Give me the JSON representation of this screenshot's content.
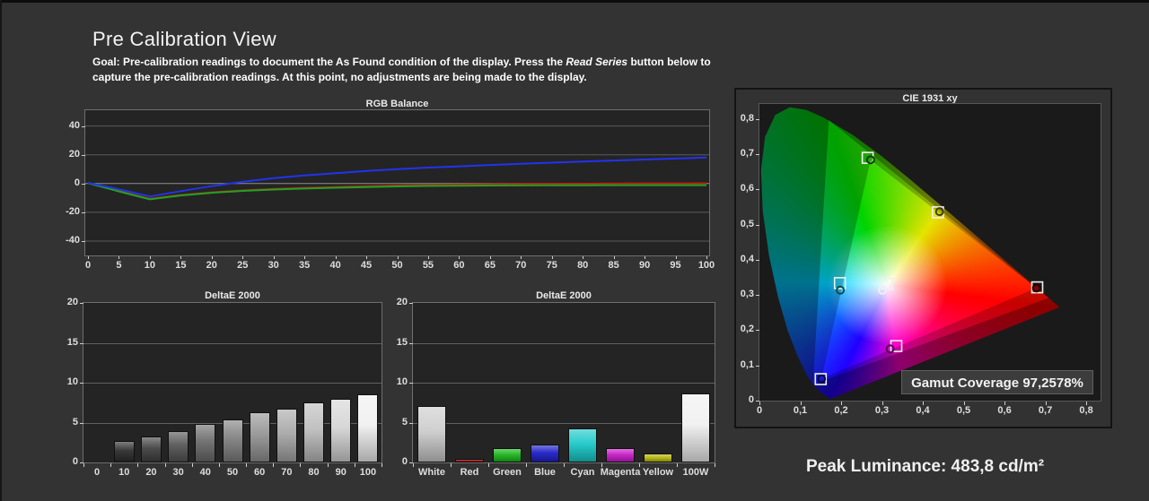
{
  "header": {
    "title": "Pre Calibration View",
    "goal": {
      "line1_pre": "Goal: Pre-calibration readings to document the As Found condition of the display. Press the ",
      "line1_italic": "Read Series",
      "line1_post": " button below to",
      "line2": "capture the pre-calibration readings. At this point, no adjustments are being made to the display."
    }
  },
  "footer": {
    "peak_luminance": "Peak Luminance: 483,8 cd/m²"
  },
  "colors": {
    "page_bg": "#333333",
    "plot_bg": "#242424",
    "grid": "#5a5a5a",
    "zero_line": "#8f8f8f",
    "axis_text": "#dedede",
    "red_line": "#bb2211",
    "green_line": "#22a022",
    "blue_line": "#2233ee"
  },
  "chart_data": [
    {
      "id": "rgb_balance",
      "type": "line",
      "title": "RGB Balance",
      "xlim": [
        0,
        100
      ],
      "ylim": [
        -50,
        51
      ],
      "xticks": [
        0,
        5,
        10,
        15,
        20,
        25,
        30,
        35,
        40,
        45,
        50,
        55,
        60,
        65,
        70,
        75,
        80,
        85,
        90,
        95,
        100
      ],
      "yticks": [
        40,
        20,
        0,
        -20,
        -40
      ],
      "x": [
        0,
        5,
        10,
        15,
        20,
        25,
        30,
        35,
        40,
        45,
        50,
        55,
        60,
        65,
        70,
        75,
        80,
        85,
        90,
        95,
        100
      ],
      "series": [
        {
          "name": "red",
          "color": "#bb2211",
          "values": [
            0.4,
            -5.2,
            -10.6,
            -8,
            -6.1,
            -4.8,
            -3.8,
            -3,
            -2.4,
            -1.9,
            -1.4,
            -1,
            -0.7,
            -0.5,
            -0.3,
            -0.2,
            -0.1,
            0,
            0.1,
            0.1,
            0.2
          ]
        },
        {
          "name": "green",
          "color": "#22a022",
          "values": [
            0.3,
            -5.5,
            -11,
            -8.3,
            -6.4,
            -5.1,
            -4.2,
            -3.5,
            -2.9,
            -2.4,
            -2,
            -1.7,
            -1.5,
            -1.4,
            -1.3,
            -1.2,
            -1.2,
            -1.1,
            -1.1,
            -1.1,
            -1.1
          ]
        },
        {
          "name": "blue",
          "color": "#2233ee",
          "values": [
            0.5,
            -4,
            -9,
            -5.3,
            -1.8,
            1.2,
            3.8,
            5.6,
            7.2,
            8.7,
            10,
            11.1,
            12,
            12.9,
            13.7,
            14.5,
            15.3,
            16,
            16.7,
            17.4,
            18.1
          ]
        }
      ],
      "grid": true,
      "legend": "none"
    },
    {
      "id": "deltae_grayscale",
      "type": "bar",
      "title": "DeltaE 2000",
      "categories": [
        "0",
        "10",
        "20",
        "30",
        "40",
        "50",
        "60",
        "70",
        "80",
        "90",
        "100"
      ],
      "values": [
        0,
        2.7,
        3.3,
        3.9,
        4.8,
        5.4,
        6.3,
        6.8,
        7.5,
        8.0,
        8.6
      ],
      "colors": [
        "#222222",
        "#2e2e2e",
        "#424242",
        "#565656",
        "#6c6c6c",
        "#808080",
        "#949494",
        "#a8a8a8",
        "#bdbdbd",
        "#d5d5d5",
        "#f0f0f0"
      ],
      "ylim": [
        0,
        20
      ],
      "yticks": [
        0,
        5,
        10,
        15,
        20
      ],
      "grid": true,
      "legend": "none"
    },
    {
      "id": "deltae_colors",
      "type": "bar",
      "title": "DeltaE 2000",
      "categories": [
        "White",
        "Red",
        "Green",
        "Blue",
        "Cyan",
        "Magenta",
        "Yellow",
        "100W"
      ],
      "values": [
        7.1,
        0.5,
        1.8,
        2.3,
        4.3,
        1.8,
        1.1,
        8.7
      ],
      "colors": [
        "#cccccc",
        "#a01010",
        "#1cb51c",
        "#2020c8",
        "#1cc8c8",
        "#c81cc8",
        "#b8b810",
        "#f0f0f0"
      ],
      "ylim": [
        0,
        20
      ],
      "yticks": [
        0,
        5,
        10,
        15,
        20
      ],
      "grid": true,
      "legend": "none"
    },
    {
      "id": "cie1931",
      "type": "scatter",
      "title": "CIE 1931 xy",
      "xlim": [
        0,
        0.835
      ],
      "ylim": [
        0,
        0.843
      ],
      "ticks": [
        0,
        0.1,
        0.2,
        0.3,
        0.4,
        0.5,
        0.6,
        0.7,
        0.8
      ],
      "xtick_labels": [
        "0",
        "0,1",
        "0,2",
        "0,3",
        "0,4",
        "0,5",
        "0,6",
        "0,7",
        "0,8"
      ],
      "ytick_labels": [
        "0",
        "0,1",
        "0,2",
        "0,3",
        "0,4",
        "0,5",
        "0,6",
        "0,7",
        "0,8"
      ],
      "coverage_label": "Gamut Coverage 97,2578%",
      "reference_triangle": [
        [
          0.708,
          0.292
        ],
        [
          0.17,
          0.797
        ],
        [
          0.131,
          0.046
        ]
      ],
      "display_triangle": [
        [
          0.678,
          0.32
        ],
        [
          0.272,
          0.684
        ],
        [
          0.152,
          0.062
        ]
      ],
      "points": [
        {
          "name": "white",
          "target": [
            0.313,
            0.332
          ],
          "measured": [
            0.301,
            0.314
          ],
          "measured_stroke": "#f0f0f0"
        },
        {
          "name": "red",
          "target": [
            0.68,
            0.322
          ],
          "measured": [
            0.678,
            0.32
          ],
          "measured_stroke": "#1a0000",
          "measured_fill": "#7a0000"
        },
        {
          "name": "green",
          "target": [
            0.265,
            0.69
          ],
          "measured": [
            0.272,
            0.684
          ],
          "measured_stroke": "#0b3d0b"
        },
        {
          "name": "blue",
          "target": [
            0.15,
            0.061
          ],
          "measured": [
            0.152,
            0.062
          ],
          "measured_stroke": "#0a0a33"
        },
        {
          "name": "cyan",
          "target": [
            0.197,
            0.334
          ],
          "measured": [
            0.198,
            0.314
          ],
          "measured_stroke": "#0b4d4d"
        },
        {
          "name": "magenta",
          "target": [
            0.335,
            0.155
          ],
          "measured": [
            0.32,
            0.147
          ],
          "measured_stroke": "#4d0b4d"
        },
        {
          "name": "yellow",
          "target": [
            0.437,
            0.535
          ],
          "measured": [
            0.441,
            0.537
          ],
          "measured_stroke": "#3d3d0b"
        }
      ]
    }
  ]
}
